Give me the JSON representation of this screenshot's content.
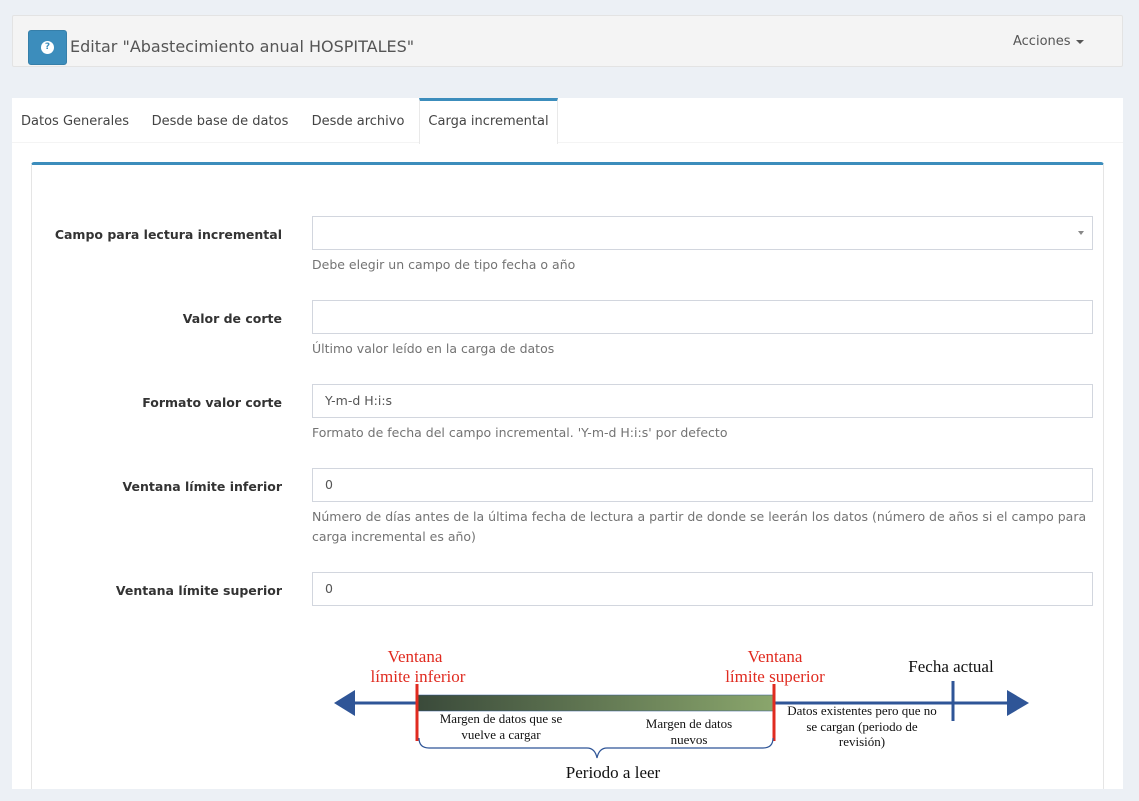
{
  "header": {
    "title": "Editar \"Abastecimiento anual HOSPITALES\"",
    "actions_label": "Acciones",
    "help_icon": "question-circle-icon"
  },
  "tabs": [
    {
      "label": "Datos Generales",
      "active": false
    },
    {
      "label": "Desde base de datos",
      "active": false
    },
    {
      "label": "Desde archivo",
      "active": false
    },
    {
      "label": "Carga incremental",
      "active": true
    }
  ],
  "form": {
    "campo": {
      "label": "Campo para lectura incremental",
      "value": "",
      "help": "Debe elegir un campo de tipo fecha o año"
    },
    "valor_corte": {
      "label": "Valor de corte",
      "value": "",
      "help": "Último valor leído en la carga de datos"
    },
    "formato": {
      "label": "Formato valor corte",
      "value": "Y-m-d H:i:s",
      "help": "Formato de fecha del campo incremental. 'Y-m-d H:i:s' por defecto"
    },
    "inferior": {
      "label": "Ventana límite inferior",
      "value": "0",
      "help": "Número de días antes de la última fecha de lectura a partir de donde se leerán los datos (número de años si el campo para carga incremental es año)"
    },
    "superior": {
      "label": "Ventana límite superior",
      "value": "0"
    }
  },
  "diagram": {
    "inferior_line1": "Ventana",
    "inferior_line2": "límite inferior",
    "superior_line1": "Ventana",
    "superior_line2": "límite superior",
    "fecha_actual": "Fecha actual",
    "margen1_line1": "Margen de datos que se",
    "margen1_line2": "vuelve a cargar",
    "margen2_line1": "Margen de datos",
    "margen2_line2": "nuevos",
    "existentes_line1": "Datos existentes pero que no",
    "existentes_line2": "se cargan (periodo de",
    "existentes_line3": "revisión)",
    "periodo": "Periodo a leer",
    "colors": {
      "red": "#e02b20",
      "blue": "#2f5597",
      "bar_dark": "#3a4a3a",
      "bar_light": "#8aa66c"
    }
  }
}
